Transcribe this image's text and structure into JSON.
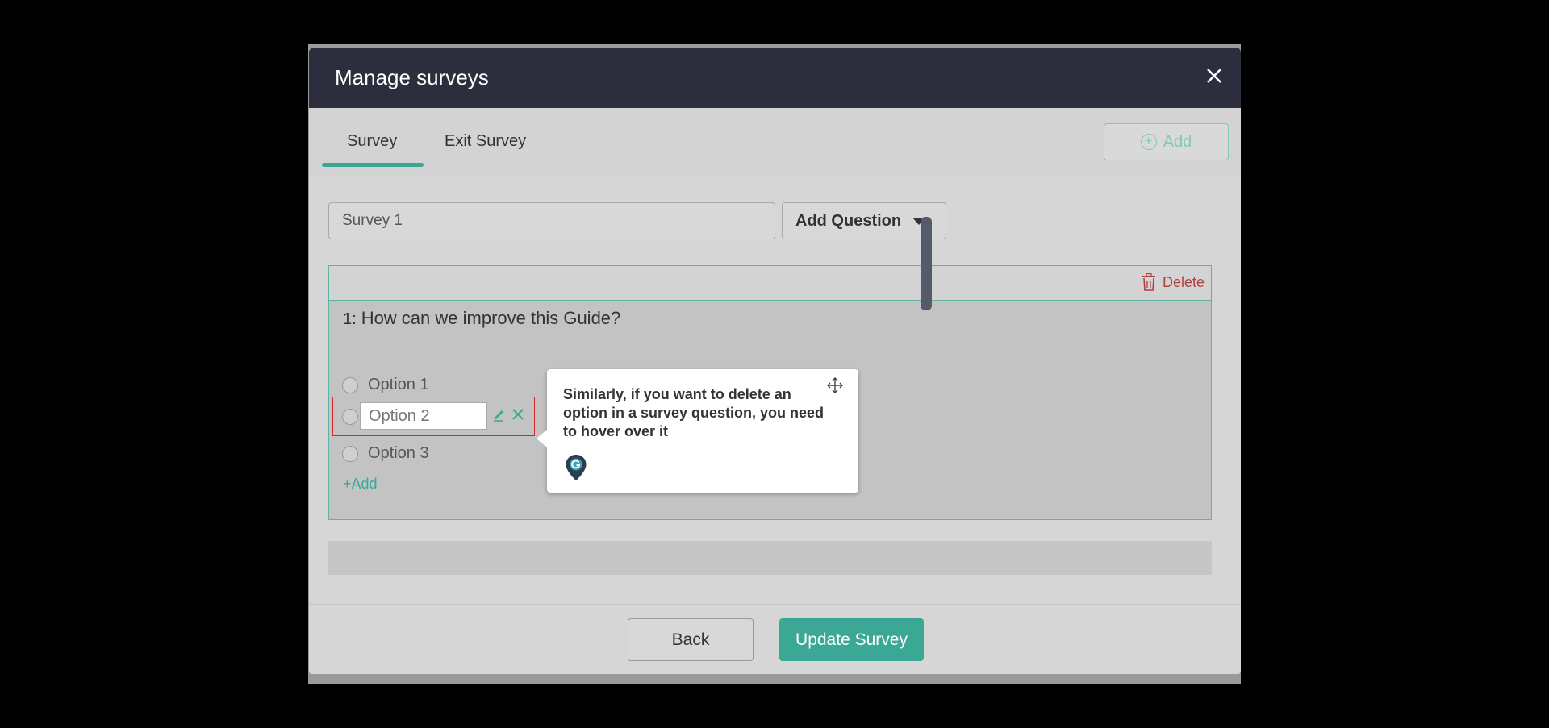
{
  "modal": {
    "title": "Manage surveys"
  },
  "tabs": [
    {
      "label": "Survey",
      "active": true
    },
    {
      "label": "Exit Survey",
      "active": false
    }
  ],
  "toolbar": {
    "add_label": "Add"
  },
  "survey": {
    "name_value": "Survey 1",
    "add_question_label": "Add Question"
  },
  "question_card": {
    "delete_label": "Delete",
    "number": "1:",
    "text": "How can we improve this Guide?",
    "options": [
      "Option 1",
      "Option 2",
      "Option 3"
    ],
    "add_option_label": "+Add"
  },
  "footer": {
    "back_label": "Back",
    "update_label": "Update Survey"
  },
  "tooltip": {
    "text": "Similarly, if you want to delete an option in a survey question, you need to hover over it"
  },
  "colors": {
    "header_bg": "#2c2e3d",
    "accent": "#3aa895",
    "delete": "#b0413e",
    "highlight": "#d9252a"
  },
  "icons": [
    "close-icon",
    "add-circle-icon",
    "caret-down-icon",
    "trash-icon",
    "edit-icon",
    "delete-option-icon",
    "move-icon",
    "guide-pin-icon"
  ]
}
